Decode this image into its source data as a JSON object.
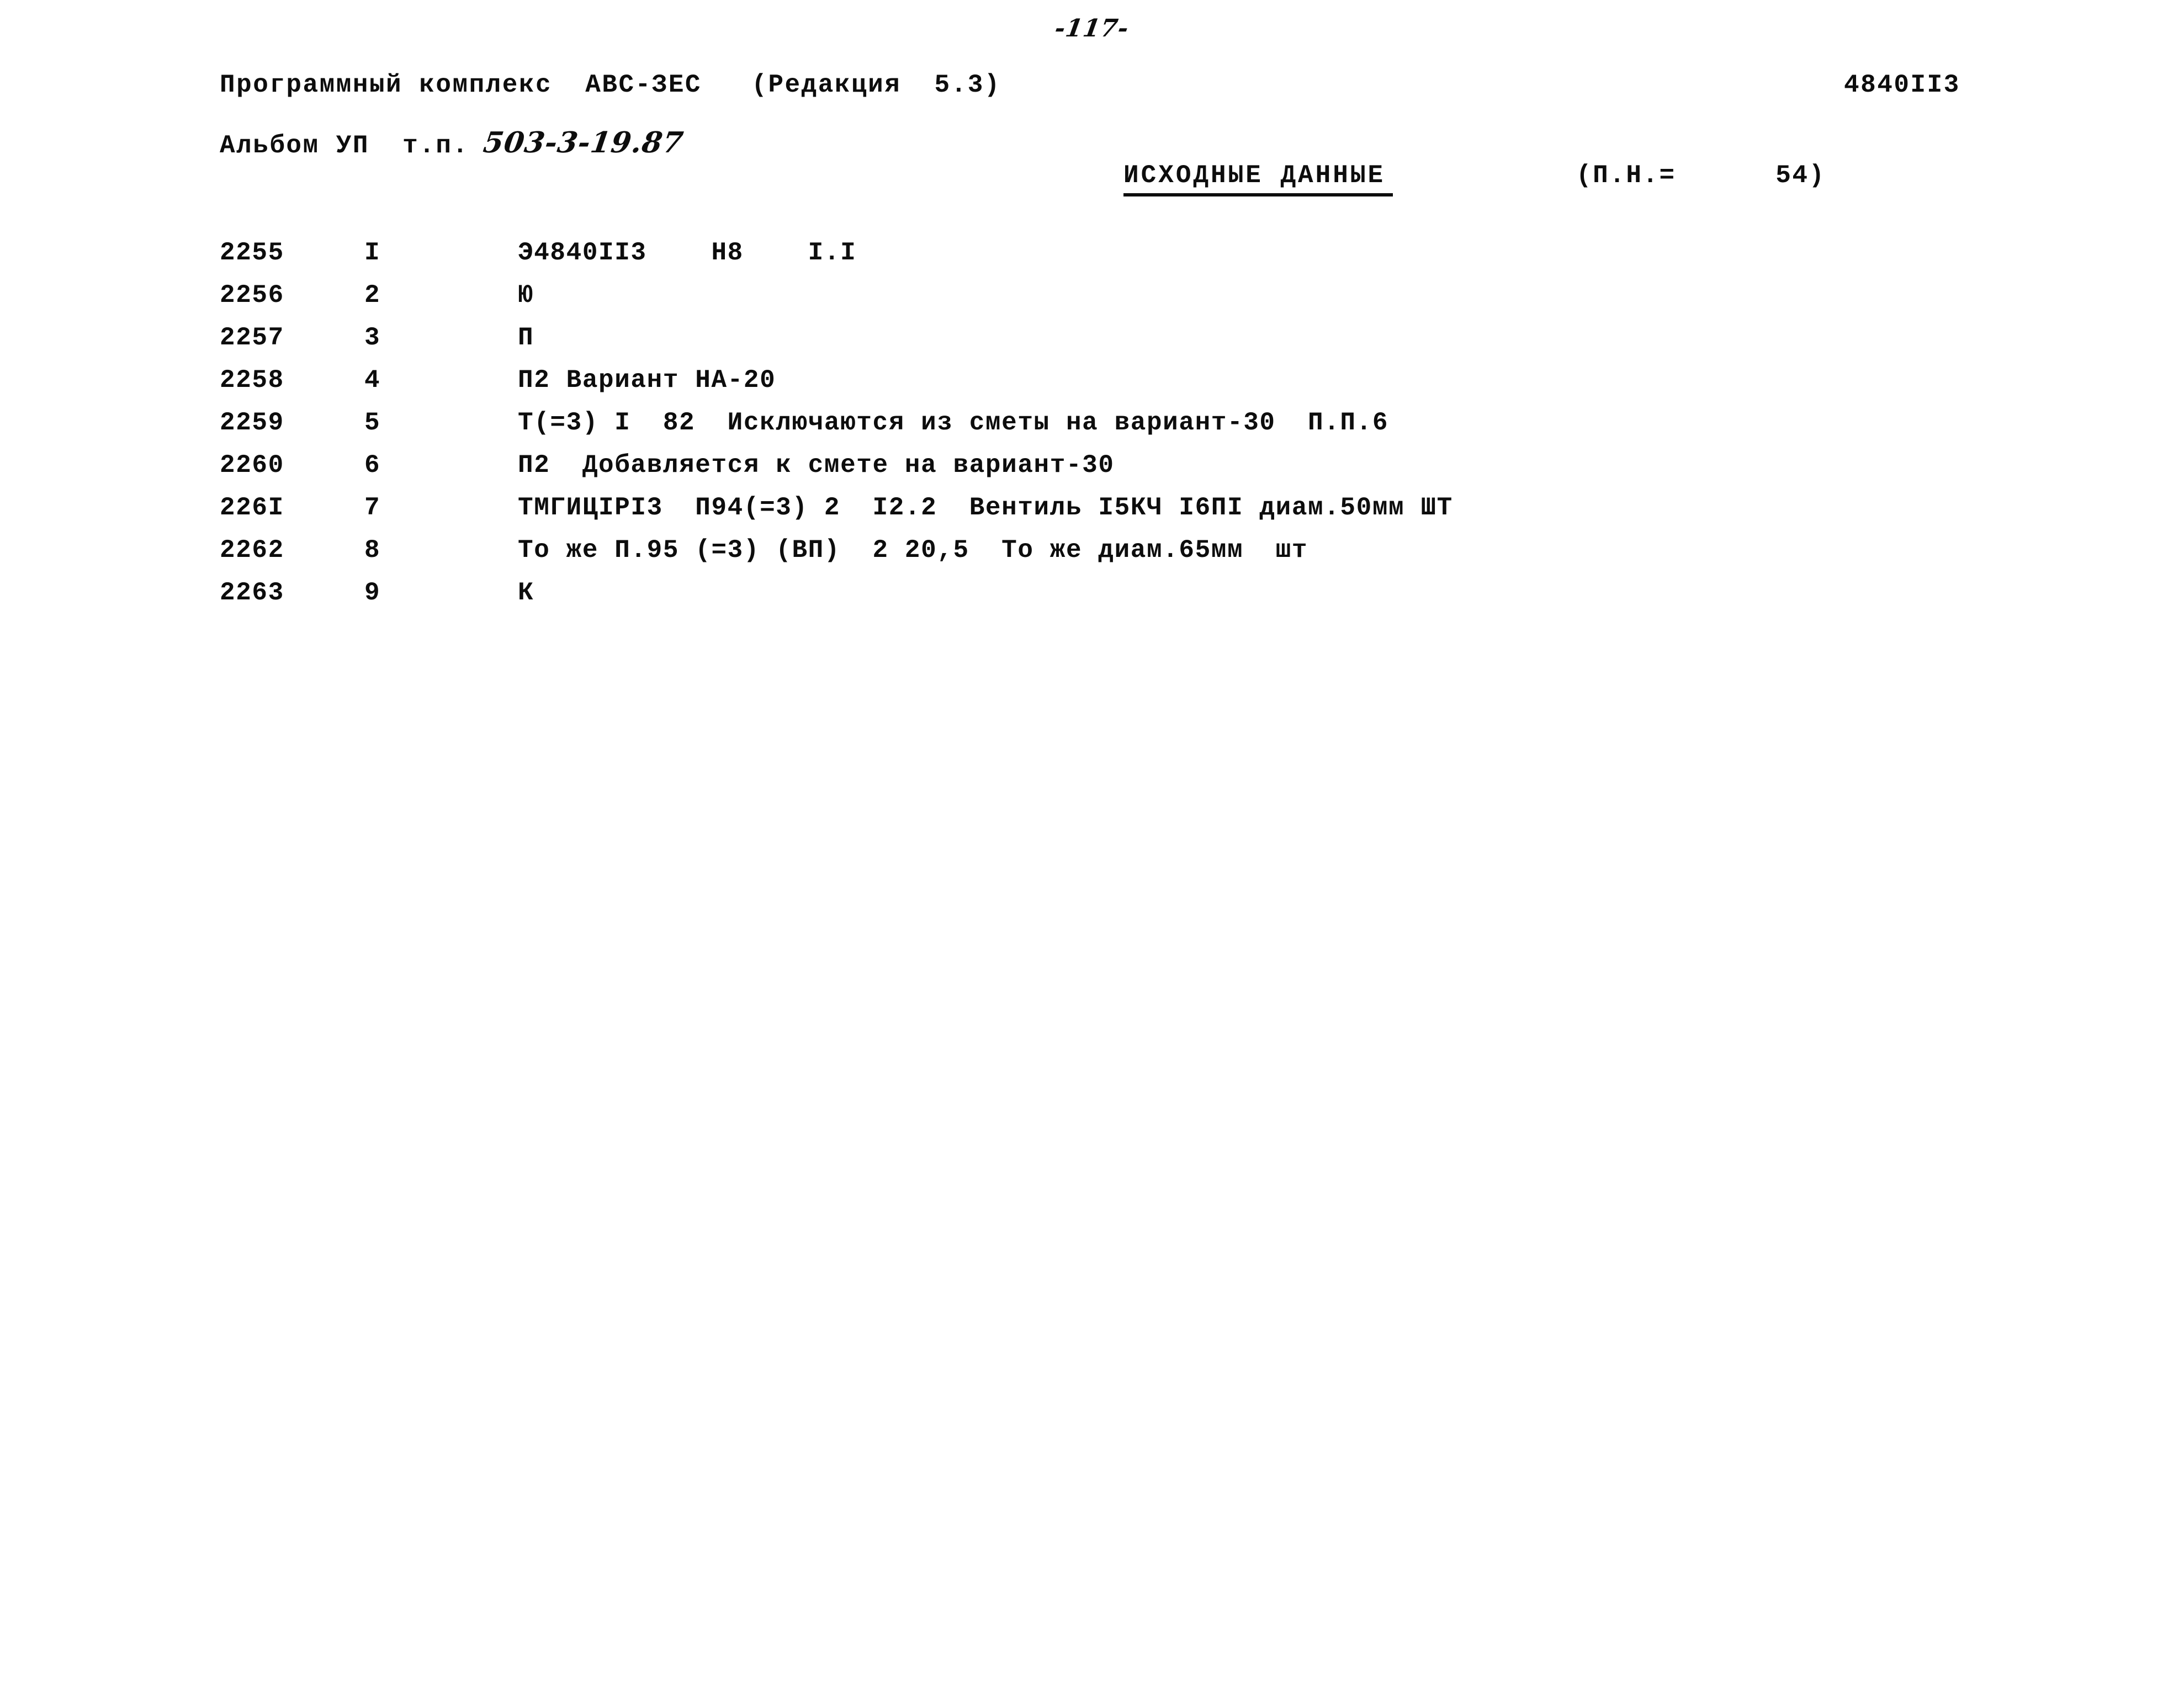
{
  "folio": "-117-",
  "header": {
    "program_line": "Программный комплекс  АВС-ЗЕС   (Редакция  5.3)",
    "doc_code": "4840II3",
    "album_label": "Альбом УП  т.п.",
    "album_code": "503-3-19.87"
  },
  "section": {
    "title": "ИСХОДНЫЕ ДАННЫЕ",
    "meta": "(П.Н.=      54)"
  },
  "listing": {
    "columns": [
      "seq",
      "ord",
      "body"
    ],
    "rows": [
      {
        "seq": "2255",
        "ord": "I",
        "body": "Э4840II3    Н8    I.I"
      },
      {
        "seq": "2256",
        "ord": "2",
        "body": "Ю"
      },
      {
        "seq": "2257",
        "ord": "3",
        "body": "П"
      },
      {
        "seq": "2258",
        "ord": "4",
        "body": "П2 Вариант НА-20"
      },
      {
        "seq": "2259",
        "ord": "5",
        "body": "Т(=3) I  82  Исключаются из сметы на вариант-30  П.П.6"
      },
      {
        "seq": "2260",
        "ord": "6",
        "body": "П2  Добавляется к смете на вариант-30"
      },
      {
        "seq": "226I",
        "ord": "7",
        "body": "ТМГИЦIРI3  П94(=3) 2  I2.2  Вентиль I5КЧ I6ПI диам.50мм ШТ"
      },
      {
        "seq": "2262",
        "ord": "8",
        "body": "То же П.95 (=3) (ВП)  2 20,5  То же диам.65мм  шт"
      },
      {
        "seq": "2263",
        "ord": "9",
        "body": "К"
      }
    ]
  }
}
